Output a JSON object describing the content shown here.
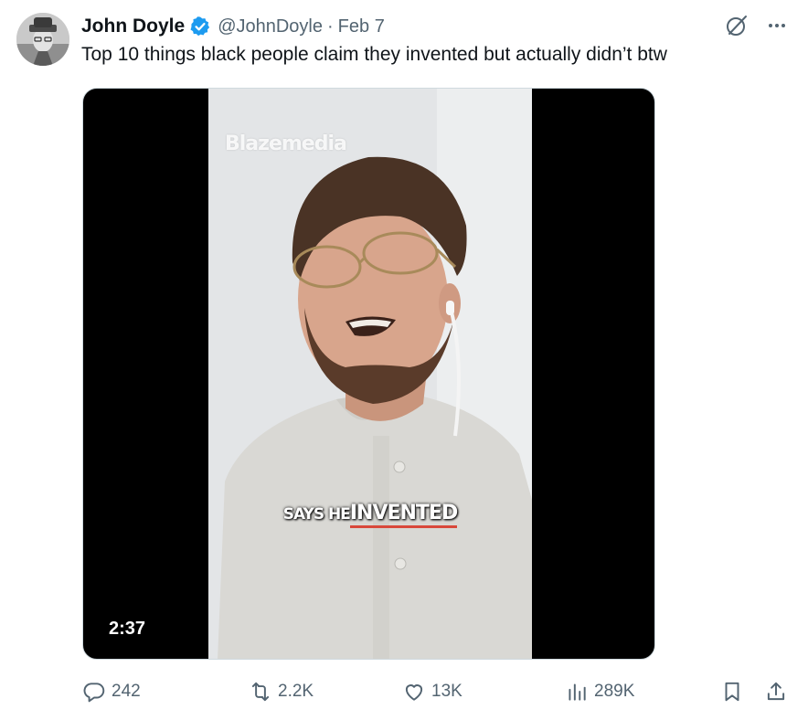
{
  "tweet": {
    "display_name": "John Doyle",
    "handle": "@JohnDoyle",
    "separator": "·",
    "date": "Feb 7",
    "text": "Top 10 things black people claim they invented but actually didn’t btw",
    "verified": true
  },
  "media": {
    "watermark": "Blazemedia",
    "caption_small": "SAYS HE",
    "caption_big": "INVENTED",
    "duration": "2:37"
  },
  "actions": {
    "replies": "242",
    "reposts": "2.2K",
    "likes": "13K",
    "views": "289K"
  },
  "icons": {
    "verified": "verified-badge-icon",
    "grok": "grok-icon",
    "more": "more-icon",
    "reply": "reply-icon",
    "repost": "repost-icon",
    "like": "heart-icon",
    "views": "views-chart-icon",
    "bookmark": "bookmark-icon",
    "share": "share-icon"
  },
  "colors": {
    "verified_blue": "#1d9bf0",
    "text_primary": "#0f1419",
    "text_secondary": "#536471",
    "caption_underline": "#d9483b"
  }
}
